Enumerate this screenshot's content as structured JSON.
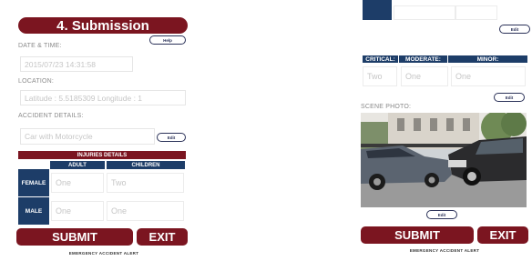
{
  "left_screen": {
    "title": "4. Submission",
    "help_label": "Help",
    "datetime": {
      "label": "DATE & TIME:",
      "value": "2015/07/23 14:31:58"
    },
    "location": {
      "label": "LOCATION:",
      "value": "Latitude : 5.5185309 Longitude : 1"
    },
    "accident": {
      "label": "ACCIDENT DETAILS:",
      "value": "Car with Motorcycle",
      "edit_label": "Edit"
    },
    "injuries": {
      "title": "INJURIES DETAILS",
      "columns": [
        "ADULT",
        "CHILDREN"
      ],
      "rows": [
        {
          "label": "FEMALE",
          "values": [
            "One",
            "Two"
          ]
        },
        {
          "label": "MALE",
          "values": [
            "One",
            "One"
          ]
        }
      ]
    },
    "submit_label": "SUBMIT",
    "exit_label": "EXIT",
    "footer": "EMERGENCY ACCIDENT ALERT"
  },
  "right_screen": {
    "top_edit_label": "Edit",
    "severity": {
      "columns": [
        "CRITICAL:",
        "MODERATE:",
        "MINOR:"
      ],
      "values": [
        "Two",
        "One",
        "One"
      ],
      "edit_label": "Edit"
    },
    "photo": {
      "label": "SCENE PHOTO:",
      "edit_label": "Edit"
    },
    "submit_label": "SUBMIT",
    "exit_label": "EXIT",
    "footer": "EMERGENCY ACCIDENT ALERT"
  },
  "colors": {
    "maroon": "#7b1520",
    "navy": "#1d3d68",
    "pill_border": "#2a3158"
  }
}
